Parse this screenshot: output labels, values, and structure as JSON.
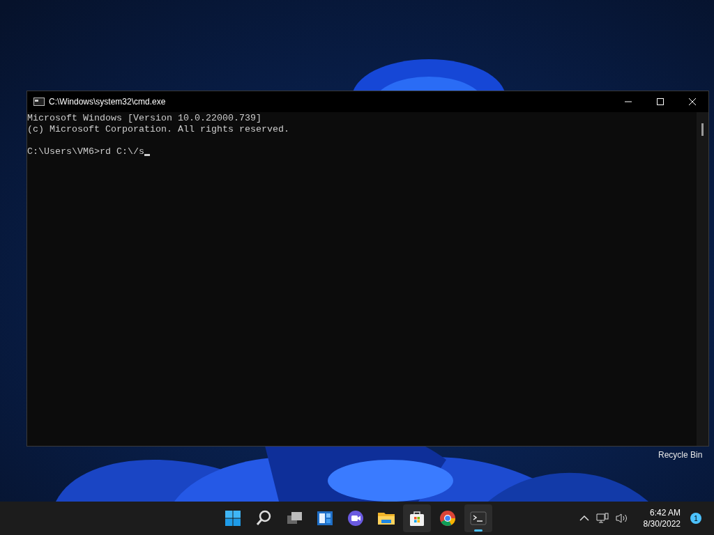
{
  "window": {
    "title": "C:\\Windows\\system32\\cmd.exe"
  },
  "console": {
    "lines": [
      "Microsoft Windows [Version 10.0.22000.739]",
      "(c) Microsoft Corporation. All rights reserved."
    ],
    "prompt": "C:\\Users\\VM6>rd C:\\/s",
    "cursor_visible": true
  },
  "desktop_icons": [
    {
      "label": "Recycle Bin"
    }
  ],
  "taskbar": {
    "apps": [
      {
        "kind": "start",
        "highlighted": false,
        "running": false
      },
      {
        "kind": "search",
        "highlighted": false,
        "running": false
      },
      {
        "kind": "taskview",
        "highlighted": false,
        "running": false
      },
      {
        "kind": "widgets",
        "highlighted": false,
        "running": false
      },
      {
        "kind": "chat",
        "highlighted": false,
        "running": false
      },
      {
        "kind": "explorer",
        "highlighted": false,
        "running": false
      },
      {
        "kind": "store",
        "highlighted": true,
        "running": false
      },
      {
        "kind": "browser",
        "highlighted": false,
        "running": false
      },
      {
        "kind": "terminal",
        "highlighted": true,
        "running": true
      }
    ],
    "tray": {
      "time": "6:42 AM",
      "date": "8/30/2022",
      "notification_count": "1"
    }
  }
}
